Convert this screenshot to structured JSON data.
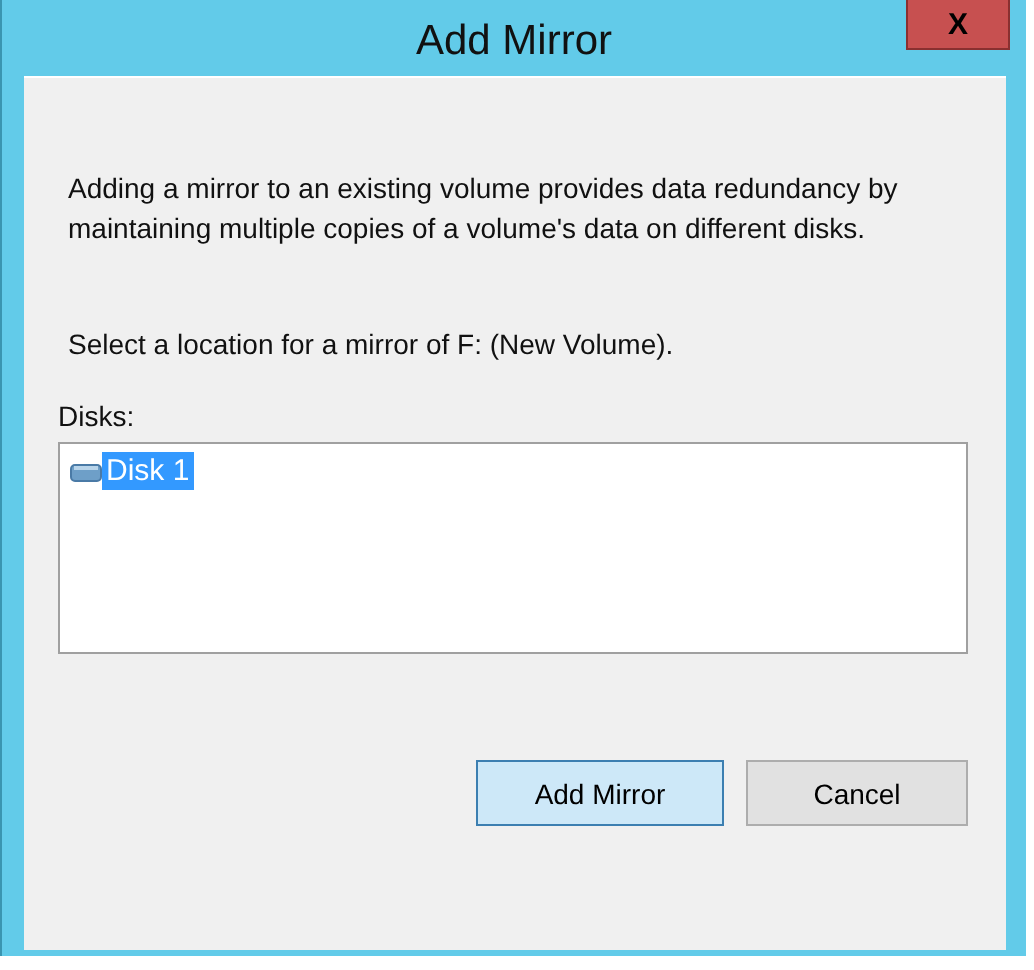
{
  "window": {
    "title": "Add Mirror",
    "close": "X"
  },
  "description": "Adding a mirror to an existing volume provides data redundancy by maintaining multiple copies of a volume's data on different disks.",
  "prompt": "Select a location for a mirror of F: (New Volume).",
  "disks": {
    "label": "Disks:",
    "items": [
      {
        "name": "Disk 1",
        "selected": true
      }
    ]
  },
  "buttons": [
    {
      "label": "Add Mirror",
      "highlighted": true
    },
    {
      "label": "Cancel",
      "highlighted": false
    }
  ]
}
